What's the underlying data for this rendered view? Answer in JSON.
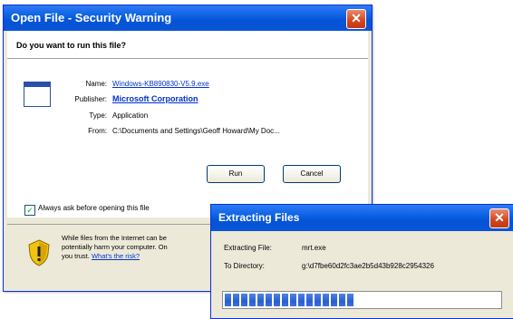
{
  "security_dialog": {
    "title": "Open File - Security Warning",
    "close_glyph": "✕",
    "question": "Do you want to run this file?",
    "name_label": "Name:",
    "name_value": "Windows-KB890830-V5.9.exe",
    "publisher_label": "Publisher:",
    "publisher_value": "Microsoft Corporation",
    "type_label": "Type:",
    "type_value": "Application",
    "from_label": "From:",
    "from_value": "C:\\Documents and Settings\\Geoff Howard\\My Doc...",
    "run_button": "Run",
    "cancel_button": "Cancel",
    "always_ask_label": "Always ask before opening this file",
    "always_ask_checked": true,
    "warning_text_1": "While files from the Internet can be",
    "warning_text_2": "potentially harm your computer. On",
    "warning_text_3": "you trust.",
    "warning_link": "What's the risk?"
  },
  "extract_dialog": {
    "title": "Extracting Files",
    "close_glyph": "✕",
    "file_label": "Extracting File:",
    "file_value": "mrt.exe",
    "dir_label": "To Directory:",
    "dir_value": "g:\\d7fbe60d2fc3ae2b5d43b928c2954326",
    "progress_fraction": 0.49
  },
  "colors": {
    "titlebar_blue": "#0a5fe0",
    "close_red": "#d2451e",
    "dialog_face": "#ece9d8",
    "link_blue": "#0033cc"
  }
}
